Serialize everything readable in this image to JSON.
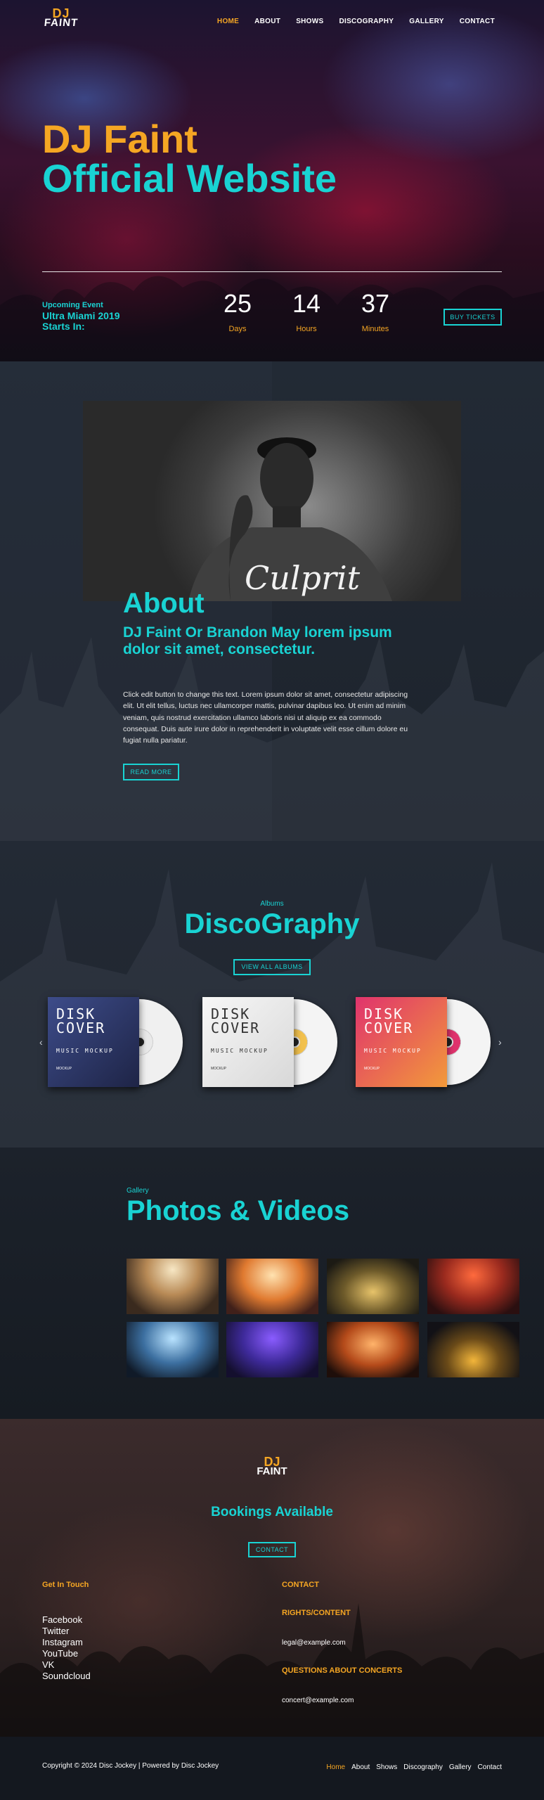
{
  "brand": {
    "logo_top": "DJ",
    "logo_bottom": "FAINT"
  },
  "nav": {
    "items": [
      {
        "label": "HOME",
        "active": true
      },
      {
        "label": "ABOUT"
      },
      {
        "label": "SHOWS"
      },
      {
        "label": "DISCOGRAPHY"
      },
      {
        "label": "GALLERY"
      },
      {
        "label": "CONTACT"
      }
    ]
  },
  "hero": {
    "title_line1": "DJ Faint",
    "title_line2": "Official Website",
    "event_label": "Upcoming Event",
    "event_name": "Ultra Miami 2019 Starts In:",
    "countdown": [
      {
        "value": "25",
        "unit": "Days"
      },
      {
        "value": "14",
        "unit": "Hours"
      },
      {
        "value": "37",
        "unit": "Minutes"
      }
    ],
    "buy_label": "BUY TICKETS"
  },
  "about": {
    "title": "About",
    "subtitle": "DJ Faint Or Brandon May lorem ipsum dolor sit amet, consectetur.",
    "body": "Click edit button to change this text. Lorem ipsum dolor sit amet, consectetur adipiscing elit. Ut elit tellus, luctus nec ullamcorper mattis, pulvinar dapibus leo. Ut enim ad minim veniam, quis nostrud exercitation ullamco laboris nisi ut aliquip ex ea commodo consequat. Duis aute irure dolor in reprehenderit in voluptate velit esse cillum dolore eu fugiat nulla pariatur.",
    "read_more": "READ MORE",
    "shirt_text": "Culprit"
  },
  "discography": {
    "label": "Albums",
    "title": "DiscoGraphy",
    "view_all": "VIEW ALL ALBUMS",
    "albums": [
      {
        "line1": "DISK",
        "line2": "COVER",
        "line3": "MUSIC MOCKUP",
        "line4": "MOCKUP",
        "color": "#2b3a70"
      },
      {
        "line1": "DISK",
        "line2": "COVER",
        "line3": "MUSIC MOCKUP",
        "line4": "MOCKUP",
        "color": "#e9e9e9"
      },
      {
        "line1": "DISK",
        "line2": "COVER",
        "line3": "MUSIC MOCKUP",
        "line4": "MOCKUP",
        "color": "#e0336d"
      }
    ],
    "prev": "‹",
    "next": "›"
  },
  "gallery": {
    "label": "Gallery",
    "title": "Photos & Videos"
  },
  "footer": {
    "bookings": "Bookings Available",
    "contact_button": "CONTACT",
    "get_in_touch": "Get In Touch",
    "social": [
      "Facebook",
      "Twitter",
      "Instagram",
      "YouTube",
      "VK",
      "Soundcloud"
    ],
    "contact_heading": "CONTACT",
    "rights_heading": "RIGHTS/CONTENT",
    "rights_email": "legal@example.com",
    "concerts_heading": "QUESTIONS ABOUT CONCERTS",
    "concerts_email": "concert@example.com",
    "copyright": "Copyright © 2024 Disc Jockey | Powered by Disc Jockey",
    "bottom_nav": [
      {
        "label": "Home",
        "active": true
      },
      {
        "label": "About"
      },
      {
        "label": "Shows"
      },
      {
        "label": "Discography"
      },
      {
        "label": "Gallery"
      },
      {
        "label": "Contact"
      }
    ]
  },
  "colors": {
    "orange": "#f5a623",
    "cyan": "#19d3d3",
    "dark": "#1a1f27"
  }
}
